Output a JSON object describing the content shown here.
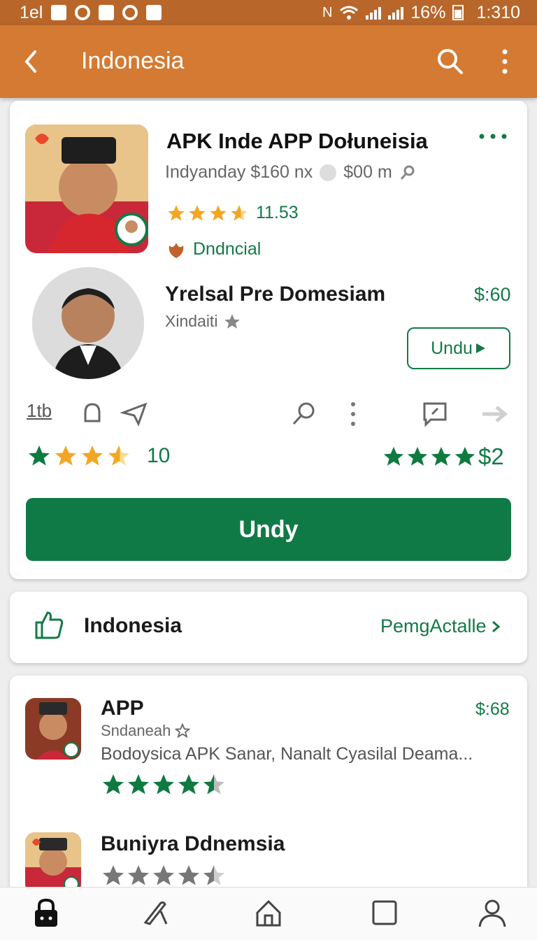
{
  "status_bar": {
    "left_text": "1el",
    "battery": "16%",
    "time": "1:310"
  },
  "app_bar": {
    "title": "Indonesia",
    "back_icon": "back-arrow-icon",
    "search_icon": "search-icon",
    "more_icon": "more-vert-icon"
  },
  "featured": {
    "title": "APK Inde APP Dołuneisia",
    "meta_1": "Indyanday $160 nx",
    "meta_2": "$00 m",
    "rating_value": "11.53",
    "category": "Dndncial",
    "secondary_title": "Yrelsal Pre Domesiam",
    "secondary_price": "$:60",
    "secondary_subtitle": "Xindaiti",
    "install_label": "Undu",
    "action_count": "1tb",
    "review_count": "10",
    "price_right": "$2",
    "primary_button": "Undy",
    "colors": {
      "accent": "#137a46",
      "star": "#f3a623"
    }
  },
  "section": {
    "label": "Indonesia",
    "link": "PemgActalle"
  },
  "list": [
    {
      "name": "APP",
      "subtitle": "Sndaneah",
      "description": "Bodoysica APK Sanar, Nanalt Cyasilal Deama...",
      "price": "$:68",
      "rating_stars": 4.5
    },
    {
      "name": "Buniyra Ddnemsia",
      "rating_stars": 4.5
    }
  ],
  "bottom_nav": {
    "items": [
      "lock-icon",
      "edit-icon",
      "home-icon",
      "square-icon",
      "profile-icon"
    ]
  }
}
